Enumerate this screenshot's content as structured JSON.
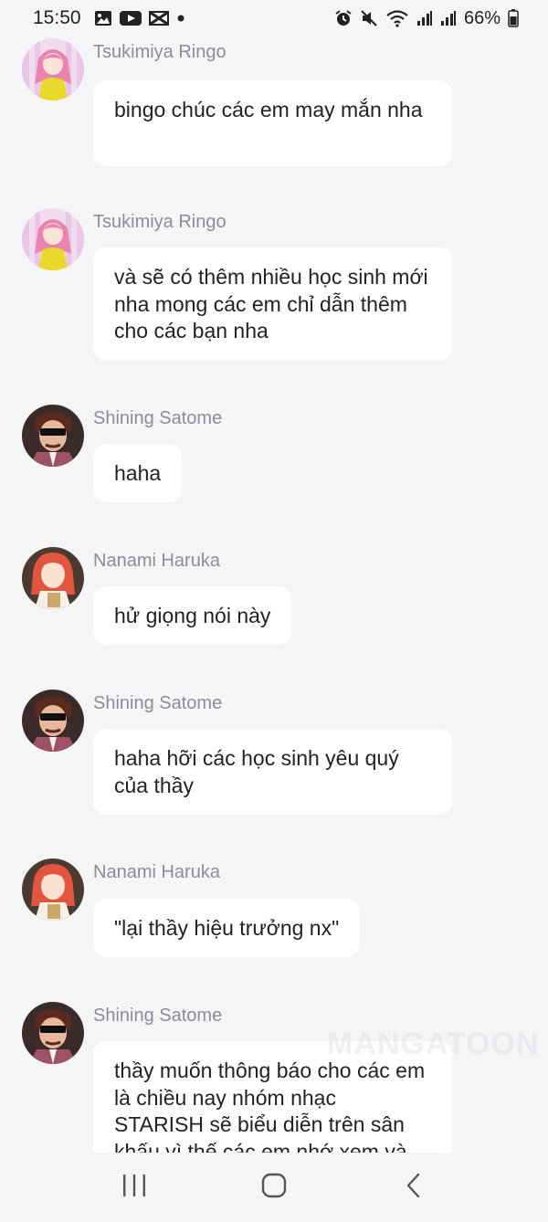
{
  "status_bar": {
    "time": "15:50",
    "battery": "66%",
    "left_icons": [
      "gallery-icon",
      "youtube-icon",
      "capcut-icon",
      "dot-icon"
    ],
    "right_icons": [
      "alarm-icon",
      "mute-icon",
      "wifi-icon",
      "signal-icon",
      "signal-icon",
      "battery-icon"
    ]
  },
  "messages": [
    {
      "sender": "Tsukimiya Ringo",
      "avatar": "ringo",
      "text": "bingo chúc các em may mắn nha"
    },
    {
      "sender": "Tsukimiya Ringo",
      "avatar": "ringo",
      "text": "và sẽ có thêm nhiều học sinh mới nha mong các em chỉ dẫn thêm cho các bạn nha"
    },
    {
      "sender": "Shining Satome",
      "avatar": "satome",
      "text": "haha"
    },
    {
      "sender": "Nanami Haruka",
      "avatar": "haruka",
      "text": "hử giọng nói này"
    },
    {
      "sender": "Shining Satome",
      "avatar": "satome",
      "text": "haha hỡi các học sinh yêu quý của thầy"
    },
    {
      "sender": "Nanami Haruka",
      "avatar": "haruka",
      "text": "\"lại thầy hiệu trưởng nx\""
    },
    {
      "sender": "Shining Satome",
      "avatar": "satome",
      "text": "thầy muốn thông báo cho các em là chiều nay nhóm nhạc STARISH sẽ biểu diễn trên sân khấu vì thế các em nhớ xem và"
    }
  ],
  "watermark": "MANGATOON",
  "nav_bar": {
    "recent_icon": "recent-apps-icon",
    "home_icon": "home-icon",
    "back_icon": "back-icon"
  },
  "colors": {
    "background": "#f4f5f7",
    "bubble": "#ffffff",
    "sender_name": "#8a8e94",
    "text": "#222222"
  }
}
